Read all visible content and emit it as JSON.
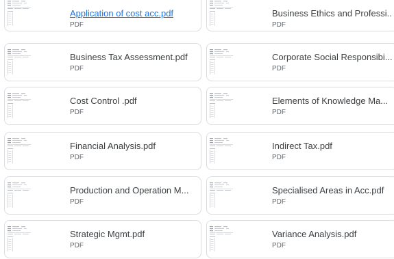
{
  "files": [
    {
      "name": "Application of cost acc.pdf",
      "type": "PDF",
      "link": true
    },
    {
      "name": "Business Ethics and Professi...",
      "type": "PDF",
      "link": false
    },
    {
      "name": "Business Tax Assessment.pdf",
      "type": "PDF",
      "link": false
    },
    {
      "name": "Corporate Social Responsibi...",
      "type": "PDF",
      "link": false
    },
    {
      "name": "Cost Control .pdf",
      "type": "PDF",
      "link": false
    },
    {
      "name": "Elements of Knowledge Ma...",
      "type": "PDF",
      "link": false
    },
    {
      "name": "Financial Analysis.pdf",
      "type": "PDF",
      "link": false
    },
    {
      "name": "Indirect Tax.pdf",
      "type": "PDF",
      "link": false
    },
    {
      "name": "Production and Operation M...",
      "type": "PDF",
      "link": false
    },
    {
      "name": "Specialised Areas in Acc.pdf",
      "type": "PDF",
      "link": false
    },
    {
      "name": "Strategic Mgmt.pdf",
      "type": "PDF",
      "link": false
    },
    {
      "name": "Variance Analysis.pdf",
      "type": "PDF",
      "link": false
    }
  ],
  "colors": {
    "border": "#dadce0",
    "link": "#1a73e8",
    "text": "#3c4043",
    "subtext": "#5f6368"
  }
}
